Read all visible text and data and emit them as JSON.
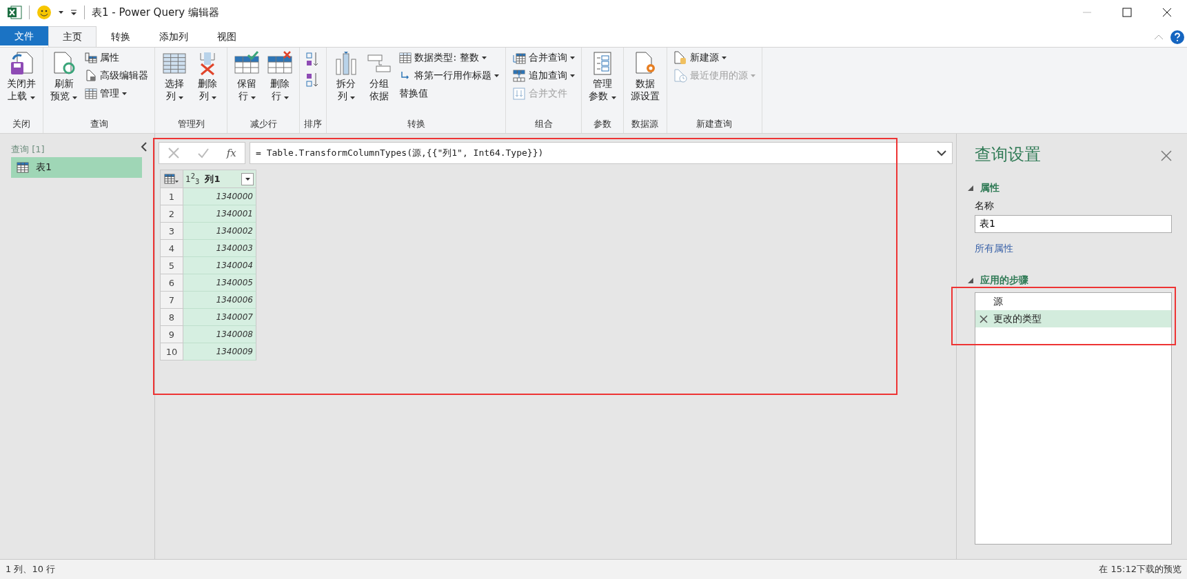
{
  "window": {
    "title": "表1 - Power Query 编辑器"
  },
  "ribbon_tabs": [
    {
      "label": "文件",
      "kind": "file",
      "selected": false
    },
    {
      "label": "主页",
      "kind": "tab",
      "selected": true
    },
    {
      "label": "转换",
      "kind": "tab",
      "selected": false
    },
    {
      "label": "添加列",
      "kind": "tab",
      "selected": false
    },
    {
      "label": "视图",
      "kind": "tab",
      "selected": false
    }
  ],
  "ribbon_groups": [
    {
      "label": "关闭",
      "items": [
        {
          "kind": "large",
          "lines": [
            "关闭并",
            "上载"
          ],
          "dropdown": true
        }
      ]
    },
    {
      "label": "查询",
      "items": [
        {
          "kind": "large",
          "lines": [
            "刷新",
            "预览"
          ],
          "dropdown": true
        },
        {
          "kind": "small",
          "label": "属性",
          "dropdown": false
        },
        {
          "kind": "small",
          "label": "高级编辑器",
          "dropdown": false
        },
        {
          "kind": "small",
          "label": "管理",
          "dropdown": true
        }
      ]
    },
    {
      "label": "管理列",
      "items": [
        {
          "kind": "large",
          "lines": [
            "选择",
            "列"
          ],
          "dropdown": true
        },
        {
          "kind": "large",
          "lines": [
            "删除",
            "列"
          ],
          "dropdown": true
        }
      ]
    },
    {
      "label": "减少行",
      "items": [
        {
          "kind": "large",
          "lines": [
            "保留",
            "行"
          ],
          "dropdown": true
        },
        {
          "kind": "large",
          "lines": [
            "删除",
            "行"
          ],
          "dropdown": true
        }
      ]
    },
    {
      "label": "排序",
      "items": [
        {
          "kind": "icon"
        },
        {
          "kind": "icon"
        }
      ]
    },
    {
      "label": "转换",
      "items": [
        {
          "kind": "large",
          "lines": [
            "拆分",
            "列"
          ],
          "dropdown": true
        },
        {
          "kind": "large",
          "lines": [
            "分组",
            "依据"
          ],
          "dropdown": false
        },
        {
          "kind": "small",
          "label": "数据类型: 整数",
          "dropdown": true
        },
        {
          "kind": "small",
          "label": "将第一行用作标题",
          "dropdown": true
        },
        {
          "kind": "small",
          "label": "替换值",
          "dropdown": false
        }
      ]
    },
    {
      "label": "组合",
      "items": [
        {
          "kind": "small",
          "label": "合并查询",
          "dropdown": true
        },
        {
          "kind": "small",
          "label": "追加查询",
          "dropdown": true
        },
        {
          "kind": "small",
          "label": "合并文件",
          "dropdown": false,
          "disabled": true
        }
      ]
    },
    {
      "label": "参数",
      "items": [
        {
          "kind": "large",
          "lines": [
            "管理",
            "参数"
          ],
          "dropdown": true
        }
      ]
    },
    {
      "label": "数据源",
      "items": [
        {
          "kind": "large",
          "lines": [
            "数据",
            "源设置"
          ],
          "dropdown": false
        }
      ]
    },
    {
      "label": "新建查询",
      "items": [
        {
          "kind": "small",
          "label": "新建源",
          "dropdown": true
        },
        {
          "kind": "small",
          "label": "最近使用的源",
          "dropdown": true,
          "disabled": true
        }
      ]
    }
  ],
  "queries_pane": {
    "title": "查询 [1]",
    "items": [
      {
        "label": "表1",
        "selected": true
      }
    ]
  },
  "formula_bar": {
    "fx": "fx",
    "formula": "= Table.TransformColumnTypes(源,{{\"列1\", Int64.Type}})"
  },
  "table": {
    "column": {
      "type_label": "1$^{2}$$_{3}$",
      "name": "列1"
    },
    "rows": [
      {
        "index": "1",
        "value": "1340000"
      },
      {
        "index": "2",
        "value": "1340001"
      },
      {
        "index": "3",
        "value": "1340002"
      },
      {
        "index": "4",
        "value": "1340003"
      },
      {
        "index": "5",
        "value": "1340004"
      },
      {
        "index": "6",
        "value": "1340005"
      },
      {
        "index": "7",
        "value": "1340006"
      },
      {
        "index": "8",
        "value": "1340007"
      },
      {
        "index": "9",
        "value": "1340008"
      },
      {
        "index": "10",
        "value": "1340009"
      }
    ]
  },
  "query_settings": {
    "title": "查询设置",
    "properties_header": "属性",
    "name_label": "名称",
    "name_value": "表1",
    "all_properties_link": "所有属性",
    "steps_header": "应用的步骤",
    "steps": [
      {
        "label": "源",
        "selected": false
      },
      {
        "label": "更改的类型",
        "selected": true
      }
    ]
  },
  "highlights": {
    "formula_and_table": true,
    "steps": true
  },
  "status_bar": {
    "left": "1 列、10 行",
    "right": "在 15:12下载的预览"
  }
}
